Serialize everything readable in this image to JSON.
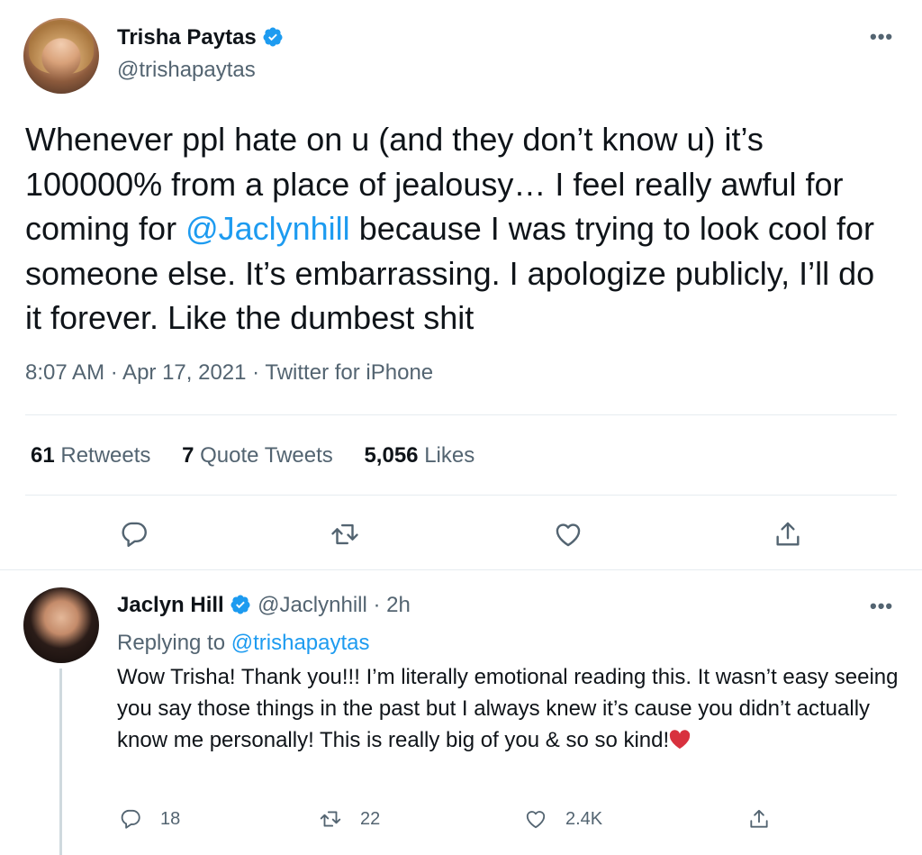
{
  "tweet": {
    "author_name": "Trisha Paytas",
    "author_handle": "@trishapaytas",
    "text_before": "Whenever ppl hate on u (and they don’t know u) it’s 100000% from a place of jealousy… I feel really awful for coming for ",
    "mention": "@Jaclynhill",
    "text_after": " because I was trying to look cool for someone else. It’s embarrassing. I apologize publicly, I’ll do it forever. Like the dumbest shit",
    "timestamp": "8:07 AM · Apr 17, 2021 · Twitter for iPhone",
    "retweets_count": "61",
    "retweets_label": "Retweets",
    "quotes_count": "7",
    "quotes_label": "Quote Tweets",
    "likes_count": "5,056",
    "likes_label": "Likes",
    "more_label": "•••"
  },
  "reply": {
    "author_name": "Jaclyn Hill",
    "author_handle": "@Jaclynhill",
    "time": "· 2h",
    "replying_prefix": "Replying to ",
    "replying_to": "@trishapaytas",
    "text": "Wow Trisha! Thank you!!! I’m literally emotional reading this. It wasn’t easy seeing you say those things in the past but I always knew it’s cause you didn’t actually know me personally! This is really big of you & so so kind!",
    "reply_count": "18",
    "retweet_count": "22",
    "like_count": "2.4K",
    "more_label": "•••"
  },
  "colors": {
    "accent": "#1d9bf0",
    "secondary_text": "#536471",
    "heart_emoji": "#d8313e"
  }
}
